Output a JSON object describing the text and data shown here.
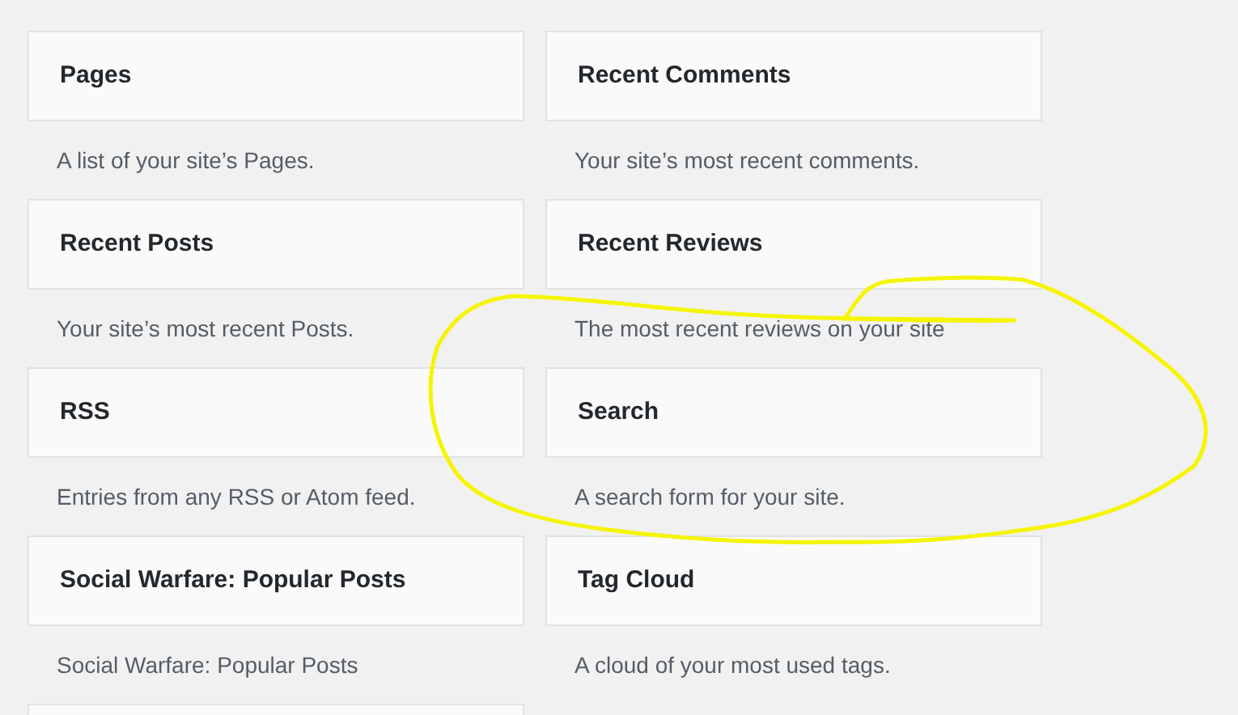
{
  "widgets": [
    {
      "title": "Pages",
      "description": "A list of your site’s Pages."
    },
    {
      "title": "Recent Comments",
      "description": "Your site’s most recent comments."
    },
    {
      "title": "Recent Posts",
      "description": "Your site’s most recent Posts."
    },
    {
      "title": "Recent Reviews",
      "description": "The most recent reviews on your site"
    },
    {
      "title": "RSS",
      "description": "Entries from any RSS or Atom feed."
    },
    {
      "title": "Search",
      "description": "A search form for your site."
    },
    {
      "title": "Social Warfare: Popular Posts",
      "description": "Social Warfare: Popular Posts"
    },
    {
      "title": "Tag Cloud",
      "description": "A cloud of your most used tags."
    }
  ]
}
